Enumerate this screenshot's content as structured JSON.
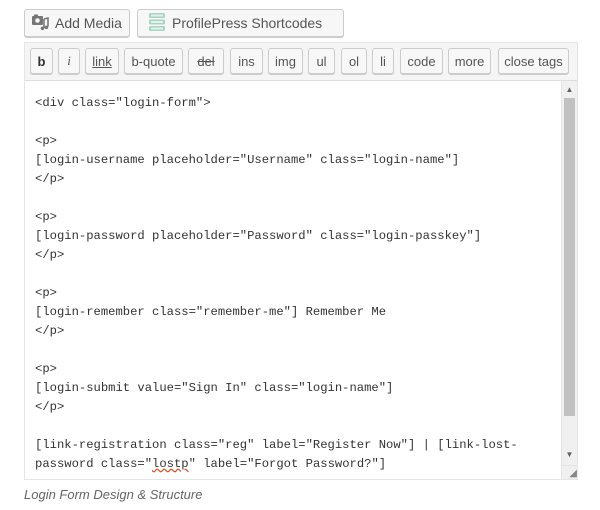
{
  "media_buttons": {
    "add_media_label": "Add Media",
    "add_media_icon": "media-camera-music-icon",
    "profilepress_label": "ProfilePress Shortcodes",
    "profilepress_icon": "profilepress-logo-icon"
  },
  "toolbar": {
    "buttons": [
      "b",
      "i",
      "link",
      "b-quote",
      "del",
      "ins",
      "img",
      "ul",
      "ol",
      "li",
      "code",
      "more",
      "close tags"
    ]
  },
  "editor": {
    "lines": [
      "<div class=\"login-form\">",
      "",
      "<p>",
      "[login-username placeholder=\"Username\" class=\"login-name\"]",
      "</p>",
      "",
      "<p>",
      "[login-password placeholder=\"Password\" class=\"login-passkey\"]",
      "</p>",
      "",
      "<p>",
      "[login-remember class=\"remember-me\"] Remember Me",
      "</p>",
      "",
      "<p>",
      "[login-submit value=\"Sign In\" class=\"login-name\"]",
      "</p>",
      "",
      "[link-registration class=\"reg\" label=\"Register Now\"] | [link-lost-",
      "password class=\""
    ],
    "misspelled": "lostp",
    "line_tail": "\" label=\"Forgot Password?\"]"
  },
  "scroll": {
    "up_arrow": "▲",
    "down_arrow": "▼",
    "resize_glyph": "◢"
  },
  "caption": "Login Form Design & Structure"
}
